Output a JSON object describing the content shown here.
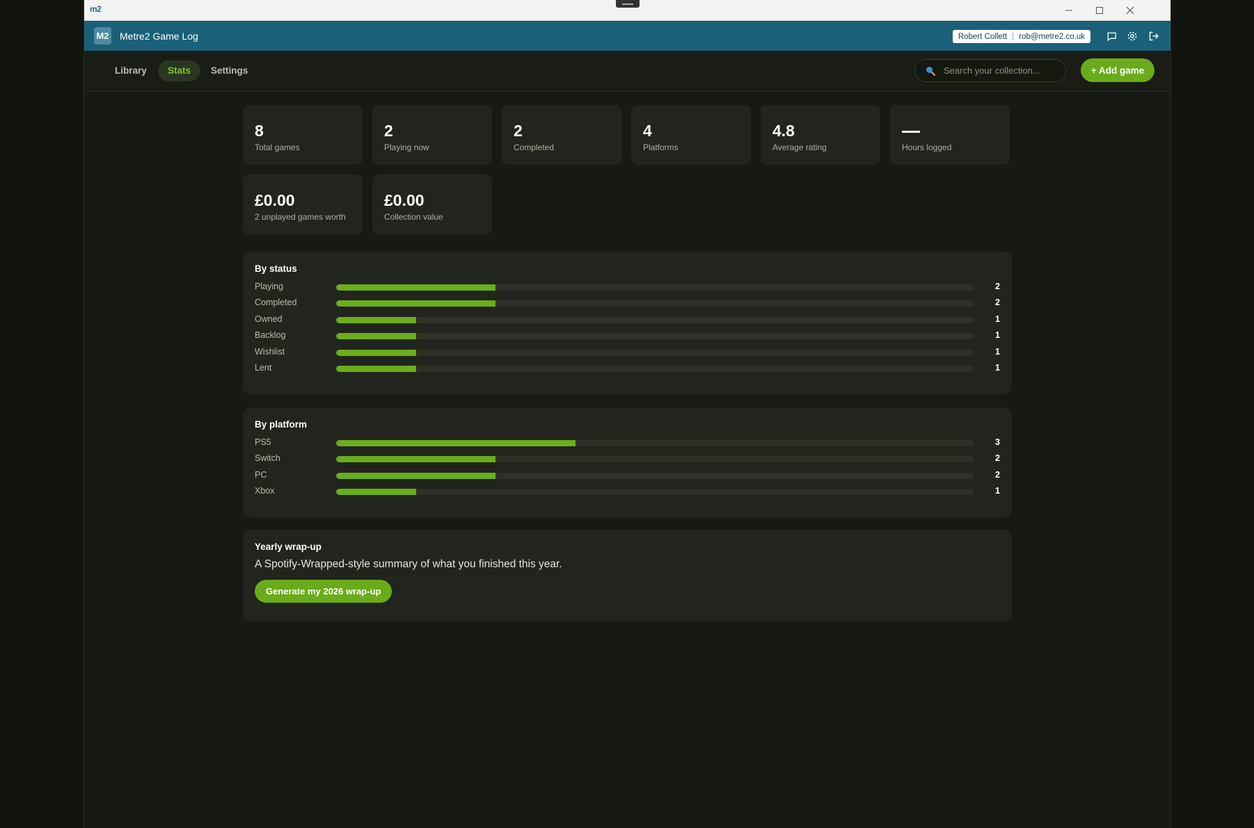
{
  "window": {
    "logo": "m2",
    "controls": {
      "minimize": "—",
      "maximize": "▢",
      "close": "✕"
    }
  },
  "appbar": {
    "badge": "M2",
    "title": "Metre2 Game Log",
    "user_name": "Robert Collett",
    "user_email": "rob@metre2.co.uk",
    "icons": [
      "chat-icon",
      "gear-icon",
      "logout-icon"
    ]
  },
  "nav": {
    "tabs": [
      {
        "label": "Library",
        "active": false
      },
      {
        "label": "Stats",
        "active": true
      },
      {
        "label": "Settings",
        "active": false
      }
    ],
    "search_placeholder": "Search your collection...",
    "add_button": "+ Add game"
  },
  "stats": {
    "cards": [
      {
        "value": "8",
        "label": "Total games"
      },
      {
        "value": "2",
        "label": "Playing now"
      },
      {
        "value": "2",
        "label": "Completed"
      },
      {
        "value": "4",
        "label": "Platforms"
      },
      {
        "value": "4.8",
        "label": "Average rating"
      },
      {
        "value": "",
        "label": "Hours logged"
      },
      {
        "value": "£0.00",
        "label": "2 unplayed games worth"
      },
      {
        "value": "£0.00",
        "label": "Collection value"
      }
    ]
  },
  "by_status": {
    "title": "By status",
    "max": 8,
    "rows": [
      {
        "label": "Playing",
        "count": 2
      },
      {
        "label": "Completed",
        "count": 2
      },
      {
        "label": "Owned",
        "count": 1
      },
      {
        "label": "Backlog",
        "count": 1
      },
      {
        "label": "Wishlist",
        "count": 1
      },
      {
        "label": "Lent",
        "count": 1
      }
    ]
  },
  "by_platform": {
    "title": "By platform",
    "max": 8,
    "rows": [
      {
        "label": "PS5",
        "count": 3
      },
      {
        "label": "Switch",
        "count": 2
      },
      {
        "label": "PC",
        "count": 2
      },
      {
        "label": "Xbox",
        "count": 1
      }
    ]
  },
  "wrapup": {
    "title": "Yearly wrap-up",
    "description": "A Spotify-Wrapped-style summary of what you finished this year.",
    "button": "Generate my 2026 wrap-up"
  },
  "colors": {
    "accent": "#6aab1b",
    "appbar": "#1b6079",
    "card": "#22251d",
    "background": "#171a14"
  }
}
